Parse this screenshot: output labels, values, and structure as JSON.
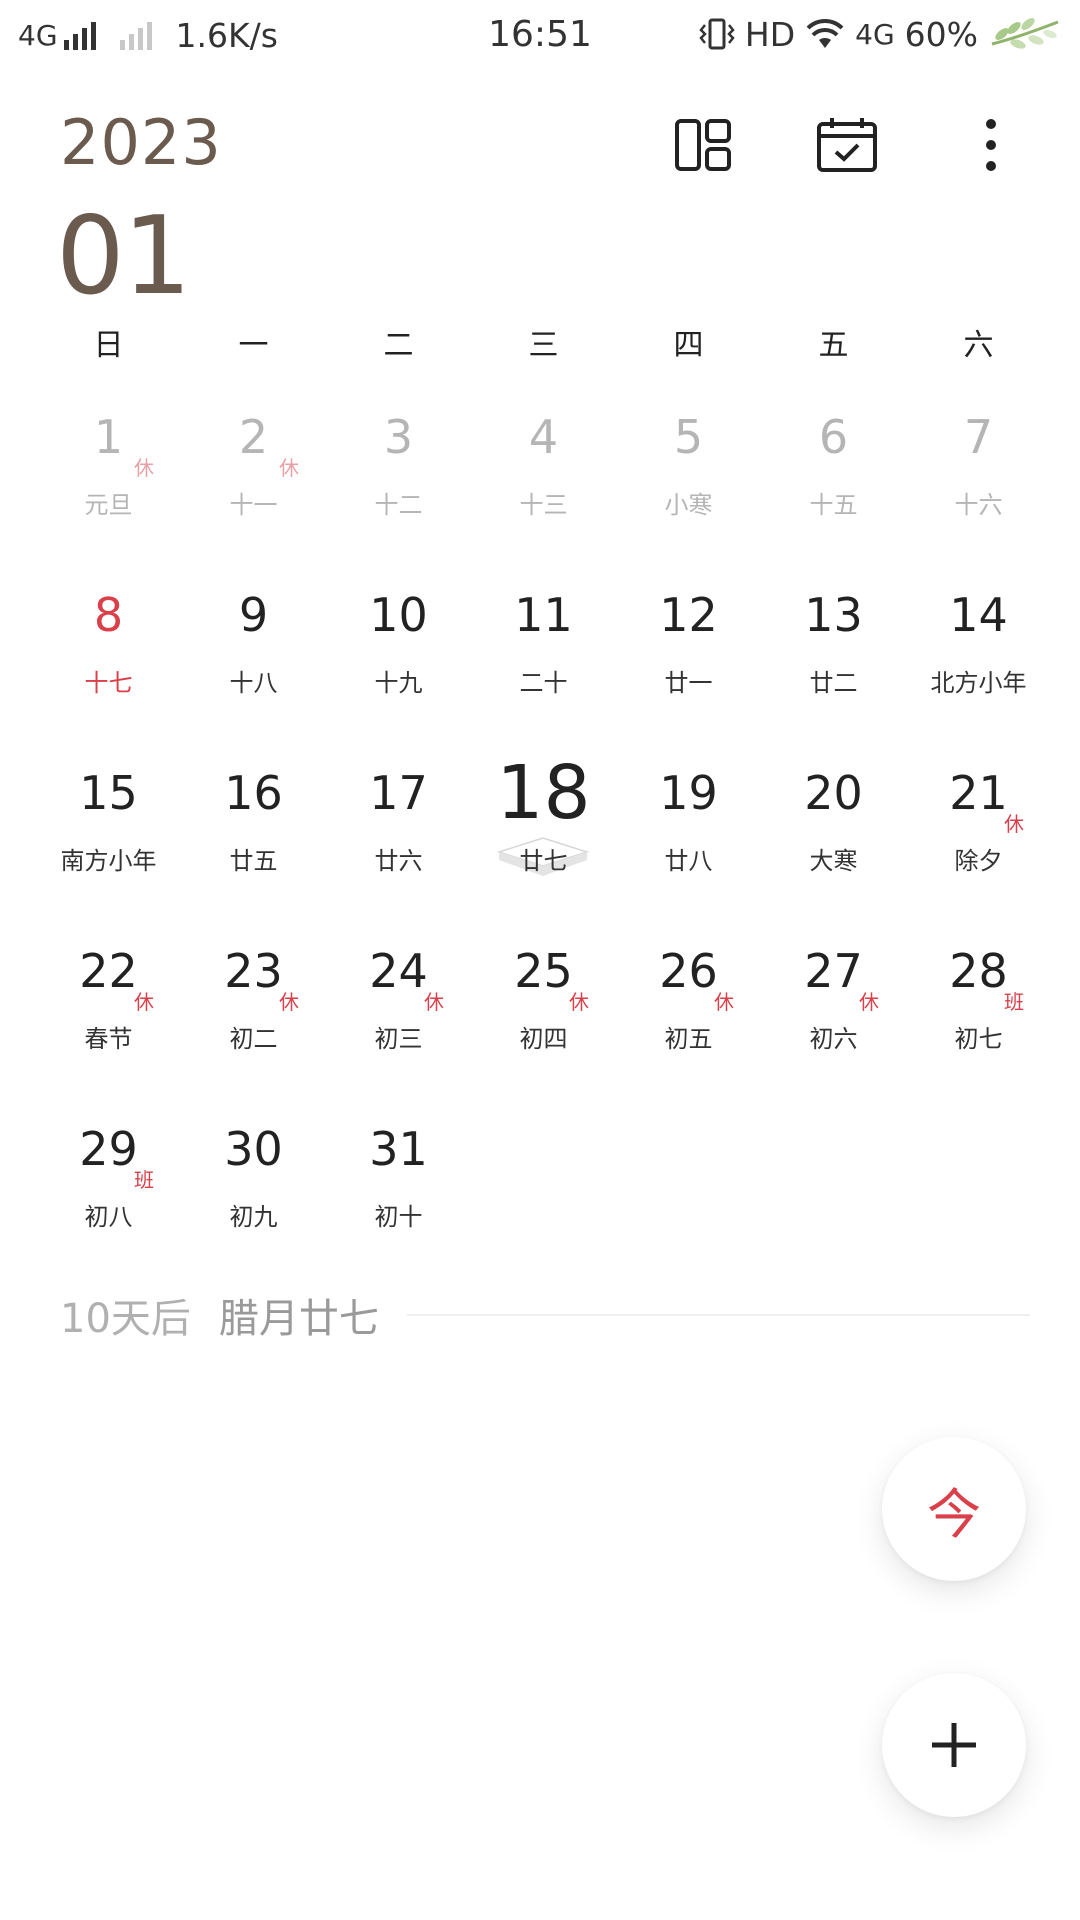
{
  "status_bar": {
    "network": "4G",
    "speed": "1.6K/s",
    "time": "16:51",
    "hd": "HD",
    "network2": "4G",
    "battery": "60%"
  },
  "header": {
    "year": "2023",
    "month": "01"
  },
  "weekdays": [
    "日",
    "一",
    "二",
    "三",
    "四",
    "五",
    "六"
  ],
  "days": [
    {
      "num": "1",
      "lunar": "元旦",
      "tag": "休"
    },
    {
      "num": "2",
      "lunar": "十一",
      "tag": "休"
    },
    {
      "num": "3",
      "lunar": "十二",
      "tag": ""
    },
    {
      "num": "4",
      "lunar": "十三",
      "tag": ""
    },
    {
      "num": "5",
      "lunar": "小寒",
      "tag": ""
    },
    {
      "num": "6",
      "lunar": "十五",
      "tag": ""
    },
    {
      "num": "7",
      "lunar": "十六",
      "tag": ""
    },
    {
      "num": "8",
      "lunar": "十七",
      "tag": ""
    },
    {
      "num": "9",
      "lunar": "十八",
      "tag": ""
    },
    {
      "num": "10",
      "lunar": "十九",
      "tag": ""
    },
    {
      "num": "11",
      "lunar": "二十",
      "tag": ""
    },
    {
      "num": "12",
      "lunar": "廿一",
      "tag": ""
    },
    {
      "num": "13",
      "lunar": "廿二",
      "tag": ""
    },
    {
      "num": "14",
      "lunar": "北方小年",
      "tag": ""
    },
    {
      "num": "15",
      "lunar": "南方小年",
      "tag": ""
    },
    {
      "num": "16",
      "lunar": "廿五",
      "tag": ""
    },
    {
      "num": "17",
      "lunar": "廿六",
      "tag": ""
    },
    {
      "num": "18",
      "lunar": "廿七",
      "tag": ""
    },
    {
      "num": "19",
      "lunar": "廿八",
      "tag": ""
    },
    {
      "num": "20",
      "lunar": "大寒",
      "tag": ""
    },
    {
      "num": "21",
      "lunar": "除夕",
      "tag": "休"
    },
    {
      "num": "22",
      "lunar": "春节",
      "tag": "休"
    },
    {
      "num": "23",
      "lunar": "初二",
      "tag": "休"
    },
    {
      "num": "24",
      "lunar": "初三",
      "tag": "休"
    },
    {
      "num": "25",
      "lunar": "初四",
      "tag": "休"
    },
    {
      "num": "26",
      "lunar": "初五",
      "tag": "休"
    },
    {
      "num": "27",
      "lunar": "初六",
      "tag": "休"
    },
    {
      "num": "28",
      "lunar": "初七",
      "tag": "班"
    },
    {
      "num": "29",
      "lunar": "初八",
      "tag": "班"
    },
    {
      "num": "30",
      "lunar": "初九",
      "tag": ""
    },
    {
      "num": "31",
      "lunar": "初十",
      "tag": ""
    }
  ],
  "countdown": {
    "days_label": "10天后",
    "lunar_label": "腊月廿七"
  },
  "fab": {
    "today_label": "今"
  },
  "icons": {
    "layout": "layout-grid-icon",
    "calendar": "calendar-check-icon",
    "more": "more-vertical-icon",
    "add": "plus-icon",
    "vibrate": "vibrate-icon",
    "wifi": "wifi-icon"
  },
  "colors": {
    "header_brown": "#6b5a4e",
    "holiday_red": "#d9404a",
    "past_gray": "#b5b5b5"
  }
}
